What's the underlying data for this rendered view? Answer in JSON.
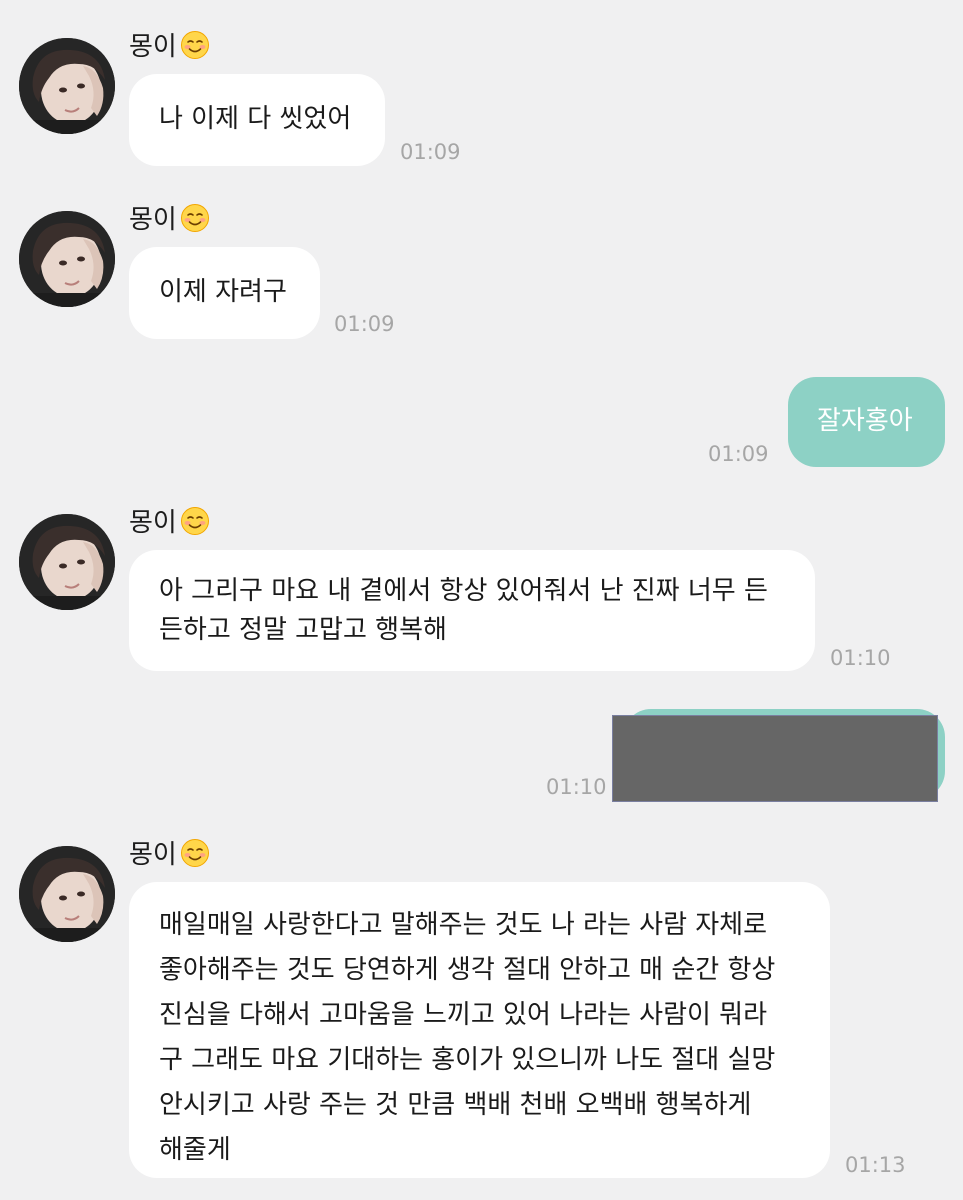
{
  "sender_name": "몽이",
  "sender_emoji_icon": "smiling-face-icon",
  "messages": [
    {
      "text": "나 이제 다 씻었어",
      "time": "01:09"
    },
    {
      "text": "이제 자려구",
      "time": "01:09"
    },
    {
      "text": "잘자홍아",
      "time": "01:09"
    },
    {
      "lines": [
        "아 그리구 마요 내 곁에서 항상 있어줘서 난 진짜 너무 든",
        "든하고 정말 고맙고 행복해"
      ],
      "time": "01:10"
    },
    {
      "time": "01:10"
    },
    {
      "lines": [
        "매일매일 사랑한다고 말해주는 것도 나 라는  사람 자체로",
        "좋아해주는 것도 당연하게 생각 절대 안하고 매 순간 항상",
        "진심을 다해서 고마움을 느끼고 있어 나라는 사람이 뭐라",
        "구 그래도 마요 기대하는 홍이가 있으니까 나도 절대 실망",
        "안시키고 사랑 주는 것 만큼 백배 천배 오백배 행복하게",
        "해줄게"
      ],
      "time": "01:13"
    }
  ],
  "colors": {
    "background": "#f0f0f1",
    "incoming_bubble": "#ffffff",
    "outgoing_bubble": "#8dd1c5",
    "timestamp": "#a6a6a6",
    "redaction": "#666666"
  }
}
